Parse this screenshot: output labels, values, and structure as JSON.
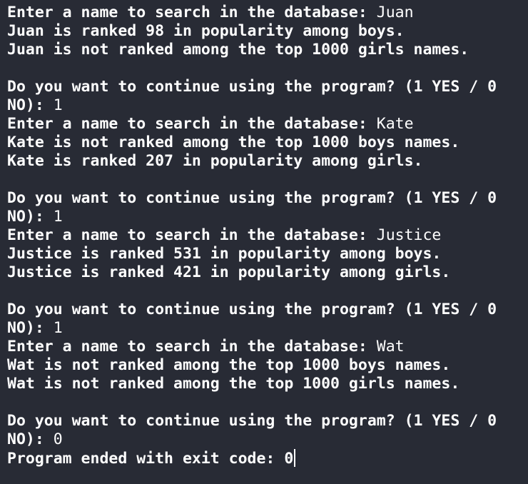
{
  "terminal": {
    "lines": [
      {
        "kind": "prompt",
        "bold": "Enter a name to search in the database: ",
        "input": "Juan"
      },
      {
        "kind": "output",
        "text": "Juan is ranked 98 in popularity among boys."
      },
      {
        "kind": "output",
        "text": "Juan is not ranked among the top 1000 girls names."
      },
      {
        "kind": "blank"
      },
      {
        "kind": "output",
        "text": "Do you want to continue using the program? (1 YES / 0"
      },
      {
        "kind": "prompt",
        "bold": "NO): ",
        "input": "1"
      },
      {
        "kind": "prompt",
        "bold": "Enter a name to search in the database: ",
        "input": "Kate"
      },
      {
        "kind": "output",
        "text": "Kate is not ranked among the top 1000 boys names."
      },
      {
        "kind": "output",
        "text": "Kate is ranked 207 in popularity among girls."
      },
      {
        "kind": "blank"
      },
      {
        "kind": "output",
        "text": "Do you want to continue using the program? (1 YES / 0"
      },
      {
        "kind": "prompt",
        "bold": "NO): ",
        "input": "1"
      },
      {
        "kind": "prompt",
        "bold": "Enter a name to search in the database: ",
        "input": "Justice"
      },
      {
        "kind": "output",
        "text": "Justice is ranked 531 in popularity among boys."
      },
      {
        "kind": "output",
        "text": "Justice is ranked 421 in popularity among girls."
      },
      {
        "kind": "blank"
      },
      {
        "kind": "output",
        "text": "Do you want to continue using the program? (1 YES / 0"
      },
      {
        "kind": "prompt",
        "bold": "NO): ",
        "input": "1"
      },
      {
        "kind": "prompt",
        "bold": "Enter a name to search in the database: ",
        "input": "Wat"
      },
      {
        "kind": "output",
        "text": "Wat is not ranked among the top 1000 boys names."
      },
      {
        "kind": "output",
        "text": "Wat is not ranked among the top 1000 girls names."
      },
      {
        "kind": "blank"
      },
      {
        "kind": "output",
        "text": "Do you want to continue using the program? (1 YES / 0"
      },
      {
        "kind": "prompt",
        "bold": "NO): ",
        "input": "0"
      },
      {
        "kind": "exit",
        "bold": "Program ended with exit code: ",
        "input": "0"
      }
    ]
  },
  "colors": {
    "background": "#282b35",
    "text": "#ffffff"
  }
}
